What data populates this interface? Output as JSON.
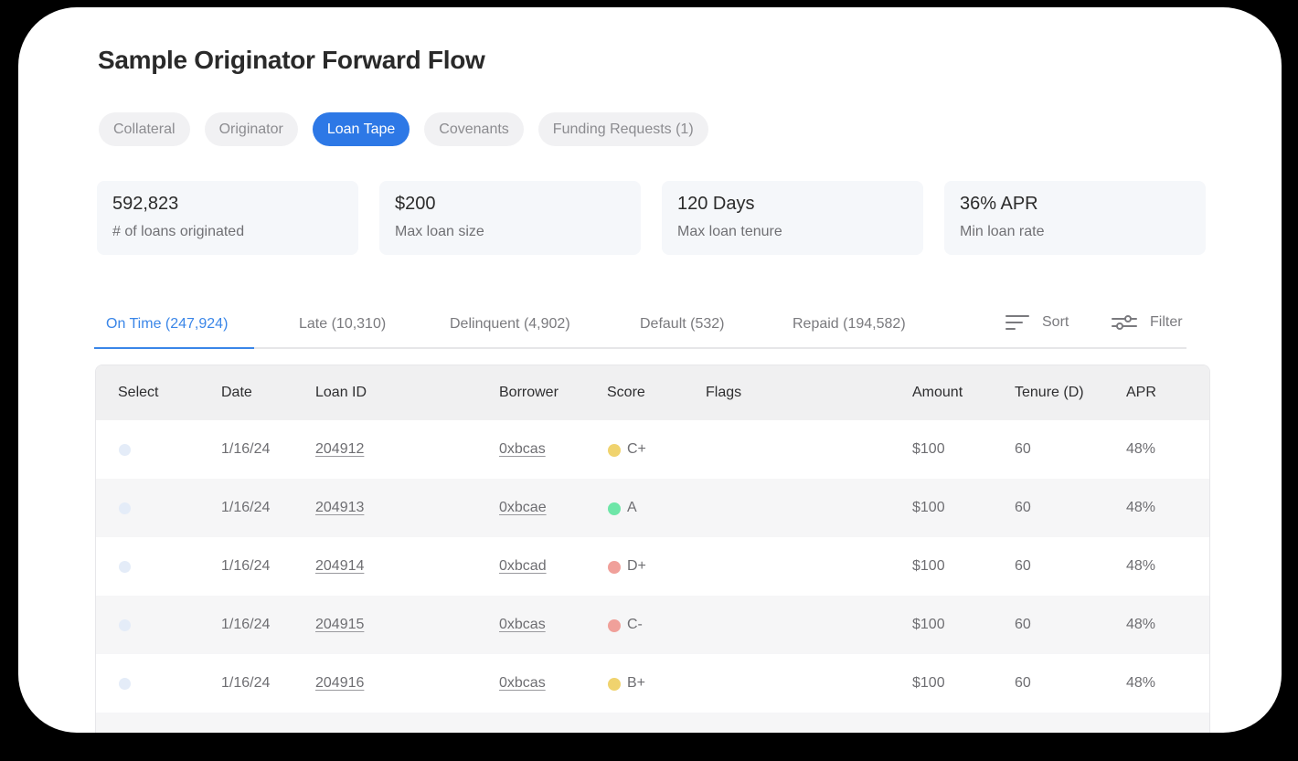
{
  "page": {
    "title": "Sample Originator Forward Flow"
  },
  "tabs": [
    {
      "label": "Collateral",
      "active": false
    },
    {
      "label": "Originator",
      "active": false
    },
    {
      "label": "Loan Tape",
      "active": true
    },
    {
      "label": "Covenants",
      "active": false
    },
    {
      "label": "Funding Requests (1)",
      "active": false
    }
  ],
  "stats": [
    {
      "value": "592,823",
      "label": "# of loans originated"
    },
    {
      "value": "$200",
      "label": "Max loan size"
    },
    {
      "value": "120 Days",
      "label": "Max loan tenure"
    },
    {
      "value": "36% APR",
      "label": "Min loan rate"
    }
  ],
  "status_tabs": [
    {
      "label": "On Time (247,924)",
      "active": true
    },
    {
      "label": "Late (10,310)",
      "active": false
    },
    {
      "label": "Delinquent (4,902)",
      "active": false
    },
    {
      "label": "Default (532)",
      "active": false
    },
    {
      "label": "Repaid (194,582)",
      "active": false
    }
  ],
  "toolbar": {
    "sort_label": "Sort",
    "filter_label": "Filter"
  },
  "table": {
    "columns": [
      "Select",
      "Date",
      "Loan ID",
      "Borrower",
      "Score",
      "Flags",
      "Amount",
      "Tenure (D)",
      "APR"
    ],
    "rows": [
      {
        "date": "1/16/24",
        "loan_id": "204912",
        "borrower": "0xbcas",
        "score": "C+",
        "score_color": "#f0d36e",
        "flags": "",
        "amount": "$100",
        "tenure": "60",
        "apr": "48%"
      },
      {
        "date": "1/16/24",
        "loan_id": "204913",
        "borrower": "0xbcae",
        "score": "A",
        "score_color": "#6ee6a8",
        "flags": "",
        "amount": "$100",
        "tenure": "60",
        "apr": "48%"
      },
      {
        "date": "1/16/24",
        "loan_id": "204914",
        "borrower": "0xbcad",
        "score": "D+",
        "score_color": "#f0a09a",
        "flags": "",
        "amount": "$100",
        "tenure": "60",
        "apr": "48%"
      },
      {
        "date": "1/16/24",
        "loan_id": "204915",
        "borrower": "0xbcas",
        "score": "C-",
        "score_color": "#f0a09a",
        "flags": "",
        "amount": "$100",
        "tenure": "60",
        "apr": "48%"
      },
      {
        "date": "1/16/24",
        "loan_id": "204916",
        "borrower": "0xbcas",
        "score": "B+",
        "score_color": "#f0d36e",
        "flags": "",
        "amount": "$100",
        "tenure": "60",
        "apr": "48%"
      }
    ]
  },
  "colors": {
    "accent": "#2d78e6",
    "tab_active_text": "#3a86e8",
    "background": "#000000",
    "card": "#ffffff"
  },
  "icons": {
    "sort": "sort-lines-icon",
    "filter": "filter-sliders-icon"
  }
}
